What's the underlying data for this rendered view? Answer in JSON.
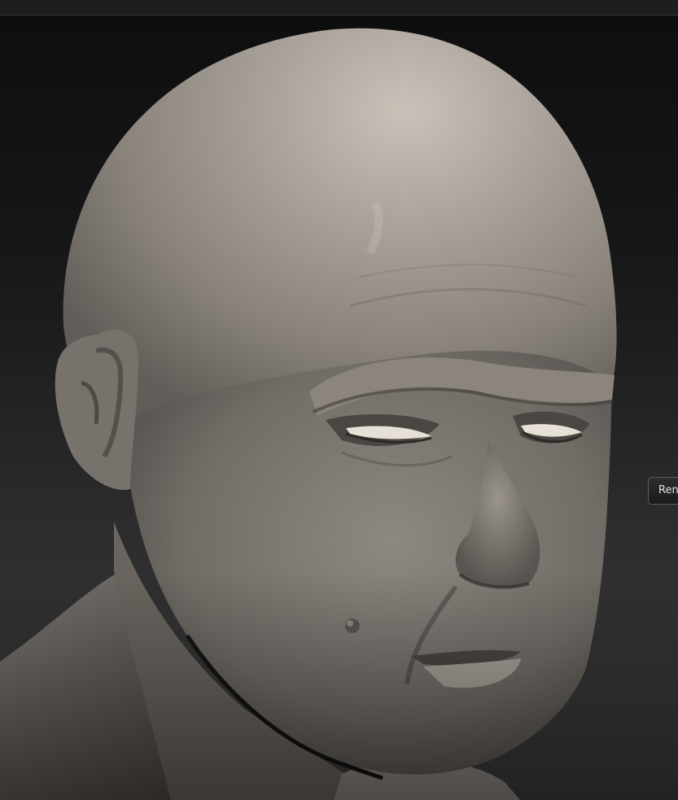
{
  "viewport": {
    "model": "sculpted-head-mesh"
  },
  "floating_tab": {
    "label": "Ren"
  },
  "colors": {
    "background_top": "#0e0e0e",
    "background_bottom": "#3e3e3e",
    "clay_light": "#b8b1a9",
    "clay_mid": "#8a847d",
    "clay_dark": "#3f3b37"
  }
}
